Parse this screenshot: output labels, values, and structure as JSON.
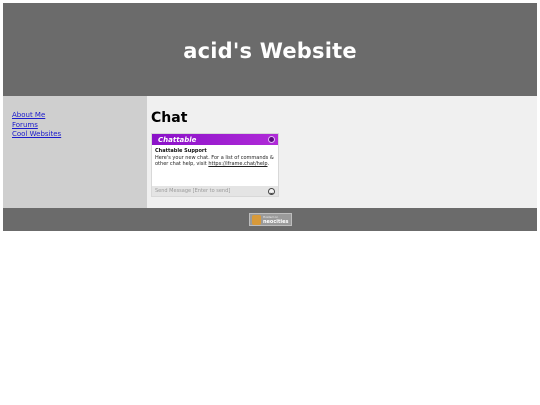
{
  "header": {
    "title": "acid's Website"
  },
  "sidebar": {
    "links": [
      {
        "label": "About Me"
      },
      {
        "label": "Forums"
      },
      {
        "label": "Cool Websites"
      }
    ]
  },
  "main": {
    "title": "Chat",
    "chat_widget": {
      "brand": "Chattable",
      "message": {
        "author": "Chattable Support",
        "text": "Here's your new chat. For a list of commands & other chat help, visit ",
        "link": "https://iframe.chat/help",
        "suffix": "."
      },
      "input_placeholder": "Send Message [Enter to send]"
    }
  },
  "footer": {
    "badge_small": "Hosted on",
    "badge_text": "neocities"
  },
  "colors": {
    "header_bg": "#6b6b6b",
    "sidebar_bg": "#cfcfcf",
    "main_bg": "#f0f0f0",
    "link": "#1a1acc",
    "widget_accent": "#9b1ad0"
  }
}
